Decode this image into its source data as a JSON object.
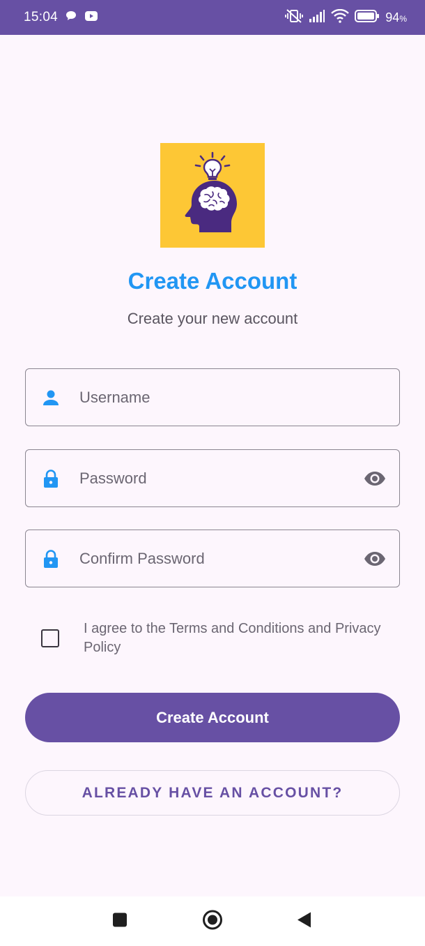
{
  "status_bar": {
    "time": "15:04",
    "battery_percent": "94",
    "battery_unit": "%",
    "icons": [
      "chat-bubble-icon",
      "youtube-icon",
      "vibrate-off-icon",
      "signal-icon",
      "wifi-icon",
      "battery-icon"
    ]
  },
  "logo": {
    "icon": "brain-lightbulb-head-icon",
    "background": "#fdc735",
    "color": "#4a2a80"
  },
  "header": {
    "title": "Create Account",
    "subtitle": "Create your new account"
  },
  "form": {
    "username": {
      "placeholder": "Username",
      "value": "",
      "icon": "person-icon"
    },
    "password": {
      "placeholder": "Password",
      "value": "",
      "icon": "lock-icon",
      "toggle_icon": "eye-icon"
    },
    "confirm_password": {
      "placeholder": "Confirm Password",
      "value": "",
      "icon": "lock-icon",
      "toggle_icon": "eye-icon"
    },
    "terms": {
      "label": "I agree to the Terms and Conditions and Privacy Policy",
      "checked": false
    }
  },
  "buttons": {
    "create_account": "Create Account",
    "already_have_account": "ALREADY HAVE AN ACCOUNT?"
  },
  "nav_bar": {
    "icons": [
      "recents-square-icon",
      "home-circle-icon",
      "back-triangle-icon"
    ]
  },
  "colors": {
    "primary": "#6750a4",
    "accent_blue": "#2196f3",
    "background": "#fdf6fd",
    "icon_grey": "#6b6672"
  }
}
